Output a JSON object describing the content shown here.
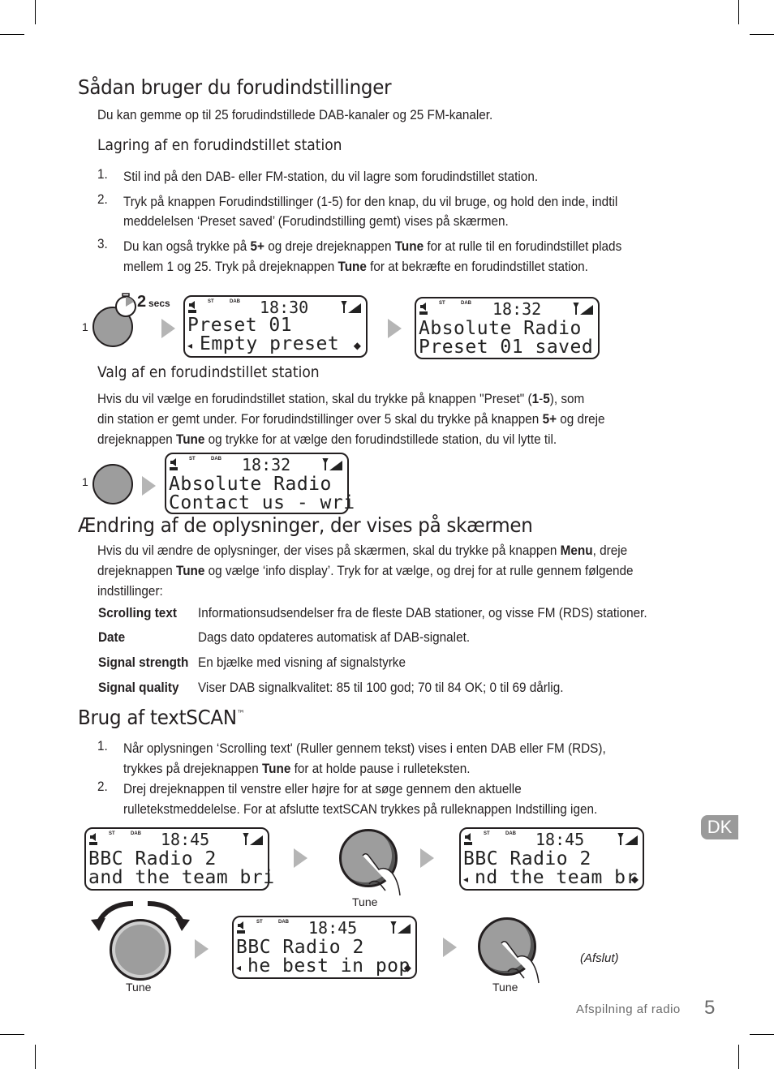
{
  "section1": {
    "heading": "Sådan bruger du forudindstillinger",
    "intro": "Du kan gemme op til 25 forudindstillede DAB-kanaler og 25 FM-kanaler.",
    "subheading": "Lagring af en forudindstillet station",
    "steps": [
      {
        "num": "1.",
        "lines": [
          "Stil ind på den DAB- eller FM-station, du vil lagre som forudindstillet station."
        ]
      },
      {
        "num": "2.",
        "lines": [
          "Tryk på knappen Forudindstillinger (1-5) for den knap, du vil bruge, og hold den inde, indtil",
          "meddelelsen ‘Preset saved’ (Forudindstilling gemt) vises på skærmen."
        ]
      },
      {
        "num": "3.",
        "line1_a": "Du kan også trykke på ",
        "line1_b": "5+",
        "line1_c": " og dreje drejeknappen ",
        "line1_d": "Tune",
        "line1_e": " for at rulle til en forudindstillet plads",
        "line2_a": "mellem 1 og 25. Tryk på drejeknappen ",
        "line2_b": "Tune",
        "line2_c": " for at bekræfte en forudindstillet station."
      }
    ],
    "figure": {
      "button_label": "1",
      "hold_time": "2",
      "hold_unit": "secs",
      "lcd1": {
        "st": "ST",
        "dab": "DAB",
        "time": "18:30",
        "line1": "Preset 01",
        "line2": "Empty preset"
      },
      "lcd2": {
        "st": "ST",
        "dab": "DAB",
        "time": "18:32",
        "line1": "Absolute Radio",
        "line2": "Preset 01 saved"
      }
    }
  },
  "section2": {
    "subheading": "Valg af en forudindstillet station",
    "para_l1a": "Hvis du vil vælge en forudindstillet station, skal du trykke på knappen \"Preset\" (",
    "para_l1b": "1",
    "para_l1c": "-",
    "para_l1d": "5",
    "para_l1e": "), som",
    "para_l2a": "din station er gemt under. For forudindstillinger over 5 skal du trykke på knappen ",
    "para_l2b": "5+",
    "para_l2c": " og dreje",
    "para_l3a": "drejeknappen ",
    "para_l3b": "Tune",
    "para_l3c": " og trykke for at vælge den forudindstillede station, du vil lytte til.",
    "figure": {
      "button_label": "1",
      "lcd": {
        "st": "ST",
        "dab": "DAB",
        "time": "18:32",
        "line1": "Absolute Radio",
        "line2": "Contact us - wri"
      }
    }
  },
  "section3": {
    "heading": "Ændring af de oplysninger, der vises på skærmen",
    "l1a": "Hvis du vil ændre de oplysninger, der vises på skærmen, skal du trykke på knappen ",
    "l1b": "Menu",
    "l1c": ", dreje",
    "l2a": "drejeknappen ",
    "l2b": "Tune",
    "l2c": " og vælge ‘info display’. Tryk for at vælge, og drej for at rulle gennem følgende",
    "l3": "indstillinger:",
    "definitions": [
      {
        "term": "Scrolling text",
        "desc": "Informationsudsendelser fra de fleste DAB stationer, og visse FM (RDS) stationer."
      },
      {
        "term": "Date",
        "desc": "Dags dato opdateres automatisk af DAB-signalet."
      },
      {
        "term": "Signal strength",
        "desc": "En bjælke med visning af signalstyrke"
      },
      {
        "term": "Signal quality",
        "desc": "Viser DAB signalkvalitet: 85 til 100 god; 70 til 84 OK; 0 til 69 dårlig."
      }
    ]
  },
  "section4": {
    "heading": "Brug af textSCAN",
    "tm": "™",
    "s1num": "1.",
    "s1l1": "Når oplysningen ‘Scrolling text' (Ruller gennem tekst) vises i enten DAB eller FM (RDS),",
    "s1l2a": "trykkes på drejeknappen ",
    "s1l2b": "Tune",
    "s1l2c": " for at holde pause i rulleteksten.",
    "s2num": "2.",
    "s2l1": "Drej drejeknappen til venstre eller højre for at søge gennem den aktuelle",
    "s2l2": "rulletekstmeddelelse. For at afslutte textSCAN trykkes på rulleknappen Indstilling igen.",
    "figure": {
      "lcd1": {
        "st": "ST",
        "dab": "DAB",
        "time": "18:45",
        "line1": "BBC Radio 2",
        "line2": "and the team bri"
      },
      "lcd2": {
        "st": "ST",
        "dab": "DAB",
        "time": "18:45",
        "line1": "BBC Radio 2",
        "line2": "nd the team br"
      },
      "lcd3": {
        "st": "ST",
        "dab": "DAB",
        "time": "18:45",
        "line1": "BBC Radio 2",
        "line2": "he best in pop"
      },
      "tune_label": "Tune",
      "exit_label": "(Afslut)"
    }
  },
  "side_tab": "DK",
  "footer": {
    "section": "Afspilning af radio",
    "page": "5"
  }
}
